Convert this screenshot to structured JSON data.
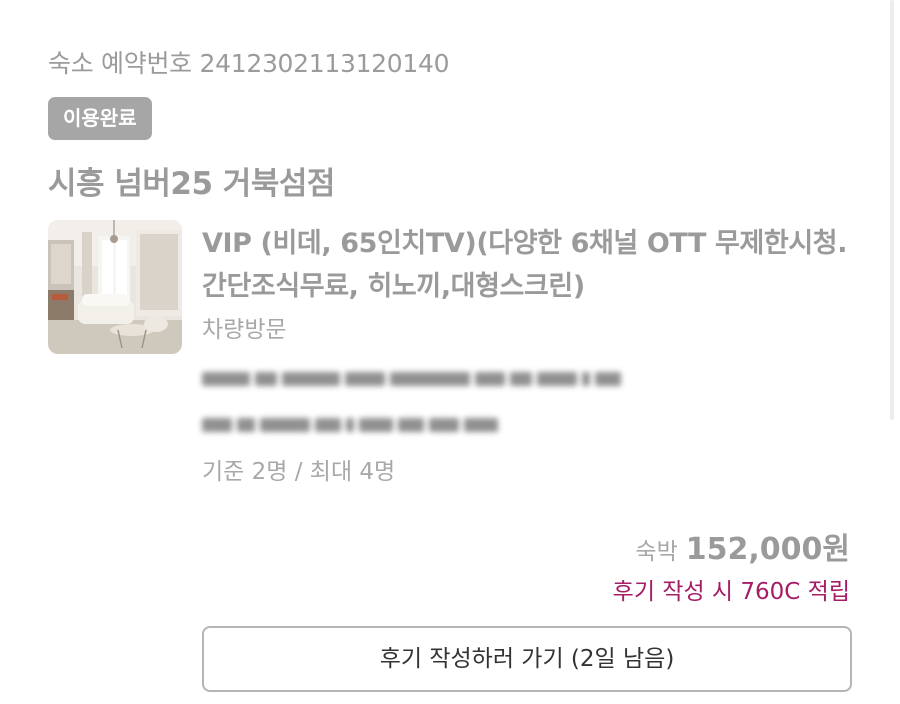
{
  "reservation": {
    "label": "숙소 예약번호",
    "number": "2412302113120140",
    "status": "이용완료"
  },
  "hotel": {
    "name": "시흥 넘버25 거북섬점"
  },
  "room": {
    "title": "VIP (비데, 65인치TV)(다양한 6채널 OTT 무제한시청.간단조식무료, 히노끼,대형스크린)",
    "visit_type": "차량방문",
    "capacity": "기준 2명 / 최대 4명",
    "image_icon": "hotel-room-photo"
  },
  "price": {
    "label": "숙박",
    "amount": "152,000원"
  },
  "reward": {
    "text": "후기 작성 시 760C 적립",
    "color": "#a51c67"
  },
  "review_button": {
    "label": "후기 작성하러 가기 (2일 남음)"
  },
  "colors": {
    "badge_bg": "#a6a6a6",
    "muted_text": "#9a9a9a"
  }
}
